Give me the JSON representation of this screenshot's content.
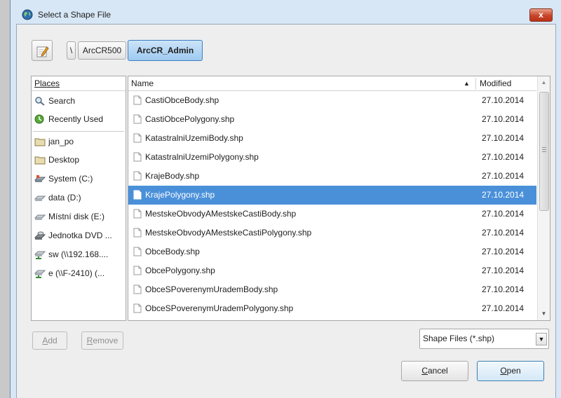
{
  "window": {
    "title": "Select a Shape File",
    "close_label": "x"
  },
  "path_bar": {
    "separator": "\\",
    "segments": [
      "ArcCR500",
      "ArcCR_Admin"
    ],
    "active_segment": "ArcCR_Admin"
  },
  "places": {
    "header": "Places",
    "items": [
      {
        "label": "Search",
        "icon": "search-icon"
      },
      {
        "label": "Recently Used",
        "icon": "recent-icon"
      },
      {
        "label": "jan_po",
        "icon": "folder-icon"
      },
      {
        "label": "Desktop",
        "icon": "folder-icon"
      },
      {
        "label": "System (C:)",
        "icon": "system-drive-icon"
      },
      {
        "label": "data (D:)",
        "icon": "drive-icon"
      },
      {
        "label": "Místní disk (E:)",
        "icon": "drive-icon"
      },
      {
        "label": "Jednotka DVD ...",
        "icon": "dvd-drive-icon"
      },
      {
        "label": "sw (\\\\192.168....",
        "icon": "network-drive-icon"
      },
      {
        "label": "e (\\\\F-2410) (...",
        "icon": "network-drive-icon"
      }
    ]
  },
  "files": {
    "columns": {
      "name": "Name",
      "modified": "Modified"
    },
    "sort": "name-ascending",
    "selected_index": 5,
    "rows": [
      {
        "name": "CastiObceBody.shp",
        "modified": "27.10.2014"
      },
      {
        "name": "CastiObcePolygony.shp",
        "modified": "27.10.2014"
      },
      {
        "name": "KatastralniUzemiBody.shp",
        "modified": "27.10.2014"
      },
      {
        "name": "KatastralniUzemiPolygony.shp",
        "modified": "27.10.2014"
      },
      {
        "name": "KrajeBody.shp",
        "modified": "27.10.2014"
      },
      {
        "name": "KrajePolygony.shp",
        "modified": "27.10.2014"
      },
      {
        "name": "MestskeObvodyAMestskeCastiBody.shp",
        "modified": "27.10.2014"
      },
      {
        "name": "MestskeObvodyAMestskeCastiPolygony.shp",
        "modified": "27.10.2014"
      },
      {
        "name": "ObceBody.shp",
        "modified": "27.10.2014"
      },
      {
        "name": "ObcePolygony.shp",
        "modified": "27.10.2014"
      },
      {
        "name": "ObceSPoverenymUrademBody.shp",
        "modified": "27.10.2014"
      },
      {
        "name": "ObceSPoverenymUrademPolygony.shp",
        "modified": "27.10.2014"
      }
    ]
  },
  "buttons": {
    "add": {
      "mnemonic": "A",
      "rest": "dd"
    },
    "remove": {
      "mnemonic": "R",
      "rest": "emove"
    },
    "cancel": {
      "mnemonic": "C",
      "rest": "ancel"
    },
    "open": {
      "mnemonic": "O",
      "rest": "pen"
    }
  },
  "filter": {
    "selected": "Shape Files (*.shp)"
  },
  "colors": {
    "selection": "#4a90d9",
    "title_bar": "#d7e7f5",
    "close_button": "#c7452a",
    "active_crumb": "#9ecaf0"
  }
}
